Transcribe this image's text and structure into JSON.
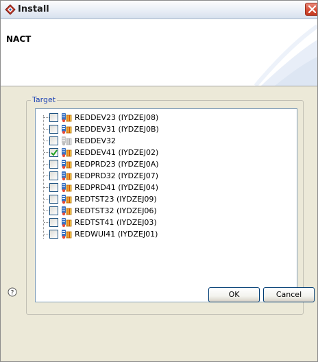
{
  "window": {
    "title": "Install",
    "icon": "install-app-icon",
    "close_icon": "close-icon"
  },
  "header": {
    "title": "NACT"
  },
  "target_group": {
    "label": "Target",
    "items": [
      {
        "label": "REDDEV23 (IYDZEJ08)",
        "checked": false,
        "icon": "region-icon",
        "enabled": true
      },
      {
        "label": "REDDEV31 (IYDZEJ0B)",
        "checked": false,
        "icon": "region-icon",
        "enabled": true
      },
      {
        "label": "REDDEV32",
        "checked": false,
        "icon": "region-icon",
        "enabled": false
      },
      {
        "label": "REDDEV41 (IYDZEJ02)",
        "checked": true,
        "icon": "region-icon",
        "enabled": true
      },
      {
        "label": "REDPRD23 (IYDZEJ0A)",
        "checked": false,
        "icon": "region-icon",
        "enabled": true
      },
      {
        "label": "REDPRD32 (IYDZEJ07)",
        "checked": false,
        "icon": "region-icon",
        "enabled": true
      },
      {
        "label": "REDPRD41 (IYDZEJ04)",
        "checked": false,
        "icon": "region-icon",
        "enabled": true
      },
      {
        "label": "REDTST23 (IYDZEJ09)",
        "checked": false,
        "icon": "region-icon",
        "enabled": true
      },
      {
        "label": "REDTST32 (IYDZEJ06)",
        "checked": false,
        "icon": "region-icon",
        "enabled": true
      },
      {
        "label": "REDTST41 (IYDZEJ03)",
        "checked": false,
        "icon": "region-icon",
        "enabled": true
      },
      {
        "label": "REDWUI41 (IYDZEJ01)",
        "checked": false,
        "icon": "region-icon",
        "enabled": true
      }
    ]
  },
  "footer": {
    "help_icon": "help-icon",
    "ok_label": "OK",
    "cancel_label": "Cancel"
  },
  "colors": {
    "group_label": "#1f45b5",
    "dialog_bg": "#ece9d8",
    "close_button": "#d64b33"
  }
}
